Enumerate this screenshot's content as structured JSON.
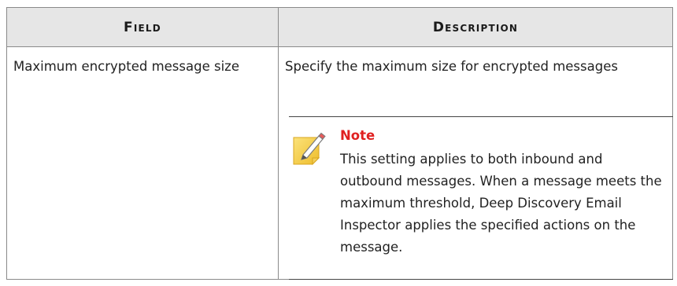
{
  "table": {
    "headers": {
      "field": "Field",
      "description": "Description"
    },
    "rows": [
      {
        "field": "Maximum encrypted message size",
        "description": "Specify the maximum size for encrypted messages",
        "note": {
          "title": "Note",
          "icon": "note-pencil-icon",
          "text": "This setting applies to both inbound and outbound messages. When a message meets the maximum threshold, Deep Discovery Email Inspector applies the specified actions on the message."
        }
      }
    ]
  },
  "colors": {
    "header_background": "#e6e6e6",
    "note_title": "#e02020",
    "note_icon_fill": "#f7d24a",
    "border": "#8a8a8a"
  }
}
